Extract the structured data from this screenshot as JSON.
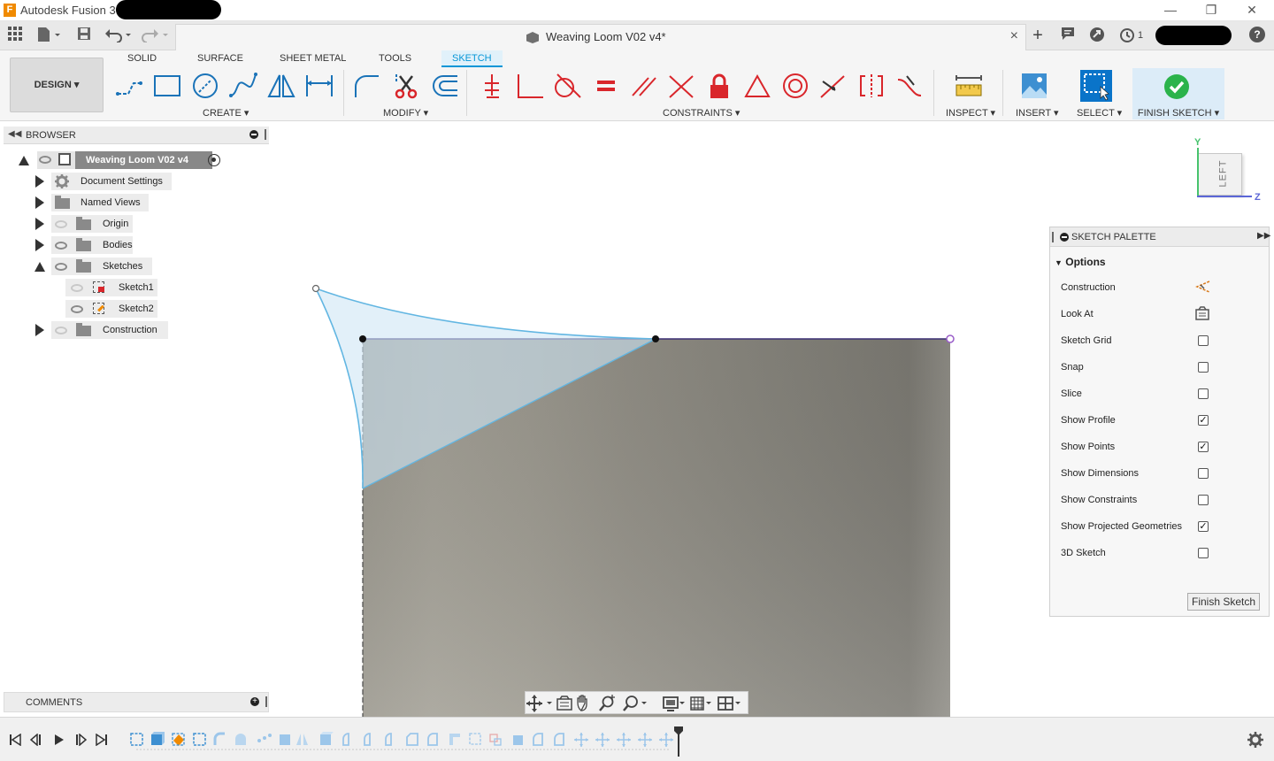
{
  "app": {
    "title": "Autodesk Fusion 360",
    "logo_letter": "F",
    "window_controls": [
      "minimize",
      "restore",
      "close"
    ]
  },
  "quick_toolbar": {
    "icons": [
      "grid-menu-icon",
      "file-icon",
      "save-icon",
      "undo-icon",
      "redo-icon"
    ]
  },
  "document_tab": {
    "title": "Weaving Loom V02 v4*",
    "close": "×"
  },
  "tab_right_icons": [
    "new-tab-icon",
    "comment-icon",
    "extensions-icon",
    "job-status-icon",
    "help-icon"
  ],
  "job_status_count": "1",
  "help": "?",
  "ribbon": {
    "workspace": "DESIGN",
    "tabs": [
      {
        "label": "SOLID",
        "active": false
      },
      {
        "label": "SURFACE",
        "active": false
      },
      {
        "label": "SHEET METAL",
        "active": false
      },
      {
        "label": "TOOLS",
        "active": false
      },
      {
        "label": "SKETCH",
        "active": true
      }
    ],
    "groups": {
      "create": "CREATE",
      "modify": "MODIFY",
      "constraints": "CONSTRAINTS",
      "inspect": "INSPECT",
      "insert": "INSERT",
      "select": "SELECT",
      "finish": "FINISH SKETCH"
    },
    "accent_color": "#0696d7",
    "constraint_color": "#d9262b"
  },
  "browser": {
    "title": "BROWSER",
    "root": "Weaving Loom V02 v4",
    "items": [
      {
        "label": "Document Settings",
        "icon": "gear-icon"
      },
      {
        "label": "Named Views",
        "icon": "folder-icon"
      },
      {
        "label": "Origin",
        "icon": "folder-icon"
      },
      {
        "label": "Bodies",
        "icon": "folder-icon"
      },
      {
        "label": "Sketches",
        "icon": "folder-icon"
      },
      {
        "label": "Sketch1",
        "icon": "sketch-icon"
      },
      {
        "label": "Sketch2",
        "icon": "sketch-icon"
      },
      {
        "label": "Construction",
        "icon": "folder-icon"
      }
    ]
  },
  "viewcube": {
    "face": "LEFT",
    "axis_y": "Y",
    "axis_z": "Z"
  },
  "sketch_palette": {
    "title": "SKETCH PALETTE",
    "section": "Options",
    "options": [
      {
        "label": "Construction",
        "type": "icon"
      },
      {
        "label": "Look At",
        "type": "icon"
      },
      {
        "label": "Sketch Grid",
        "type": "checkbox",
        "checked": false
      },
      {
        "label": "Snap",
        "type": "checkbox",
        "checked": false
      },
      {
        "label": "Slice",
        "type": "checkbox",
        "checked": false
      },
      {
        "label": "Show Profile",
        "type": "checkbox",
        "checked": true
      },
      {
        "label": "Show Points",
        "type": "checkbox",
        "checked": true
      },
      {
        "label": "Show Dimensions",
        "type": "checkbox",
        "checked": false
      },
      {
        "label": "Show Constraints",
        "type": "checkbox",
        "checked": false
      },
      {
        "label": "Show Projected Geometries",
        "type": "checkbox",
        "checked": true
      },
      {
        "label": "3D Sketch",
        "type": "checkbox",
        "checked": false
      }
    ],
    "finish_button": "Finish Sketch"
  },
  "comments": {
    "title": "COMMENTS"
  },
  "navbar": {
    "icons": [
      "orbit-icon",
      "look-at-icon",
      "pan-icon",
      "zoom-icon",
      "zoom-window-icon",
      "display-settings-icon",
      "grid-settings-icon",
      "viewports-icon"
    ]
  },
  "timeline": {
    "controls": [
      "first-icon",
      "previous-icon",
      "play-icon",
      "next-icon",
      "last-icon"
    ]
  }
}
